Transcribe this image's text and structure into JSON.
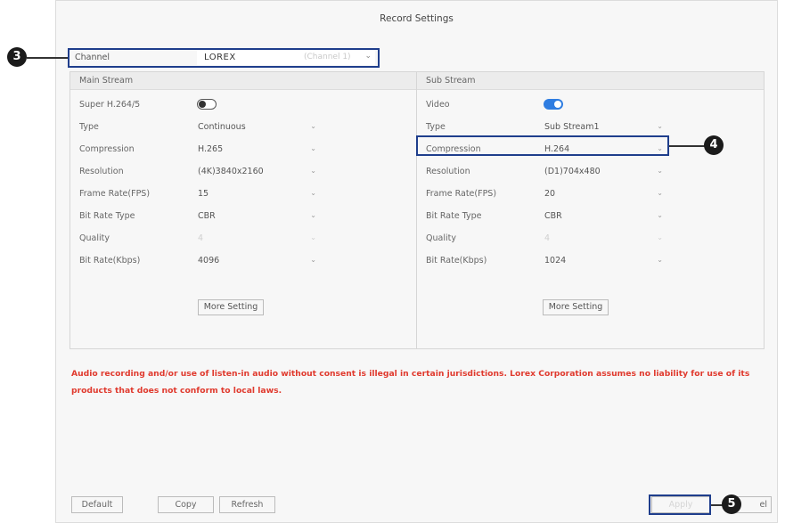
{
  "dialog": {
    "title": "Record Settings"
  },
  "channel": {
    "label": "Channel",
    "value": "LOREX",
    "sub_value": "(Channel 1)",
    "chevron": "⌄"
  },
  "main_stream": {
    "header": "Main Stream",
    "rows": [
      {
        "label": "Super H.264/5",
        "kind": "toggle",
        "state": "off"
      },
      {
        "label": "Type",
        "kind": "select",
        "value": "Continuous"
      },
      {
        "label": "Compression",
        "kind": "select",
        "value": "H.265"
      },
      {
        "label": "Resolution",
        "kind": "select",
        "value": "(4K)3840x2160"
      },
      {
        "label": "Frame Rate(FPS)",
        "kind": "select",
        "value": "15"
      },
      {
        "label": "Bit Rate Type",
        "kind": "select",
        "value": "CBR"
      },
      {
        "label": "Quality",
        "kind": "select",
        "value": "4",
        "disabled": true
      },
      {
        "label": "Bit Rate(Kbps)",
        "kind": "select",
        "value": "4096"
      }
    ],
    "more_button": "More Setting"
  },
  "sub_stream": {
    "header": "Sub Stream",
    "rows": [
      {
        "label": "Video",
        "kind": "toggle",
        "state": "on"
      },
      {
        "label": "Type",
        "kind": "select",
        "value": "Sub Stream1"
      },
      {
        "label": "Compression",
        "kind": "select",
        "value": "H.264"
      },
      {
        "label": "Resolution",
        "kind": "select",
        "value": "(D1)704x480"
      },
      {
        "label": "Frame Rate(FPS)",
        "kind": "select",
        "value": "20"
      },
      {
        "label": "Bit Rate Type",
        "kind": "select",
        "value": "CBR"
      },
      {
        "label": "Quality",
        "kind": "select",
        "value": "4",
        "disabled": true
      },
      {
        "label": "Bit Rate(Kbps)",
        "kind": "select",
        "value": "1024"
      }
    ],
    "more_button": "More Setting"
  },
  "warning": "Audio recording and/or use of listen-in audio without consent is illegal in certain jurisdictions. Lorex Corporation assumes no liability for use of its products that does not conform to local laws.",
  "buttons": {
    "default": "Default",
    "copy": "Copy",
    "refresh": "Refresh",
    "apply": "Apply",
    "cancel": "el"
  },
  "callouts": {
    "c3": "3",
    "c4": "4",
    "c5": "5"
  },
  "colors": {
    "highlight": "#1f3e8c",
    "warning": "#e03a2e",
    "toggle_on": "#2f7de1"
  }
}
